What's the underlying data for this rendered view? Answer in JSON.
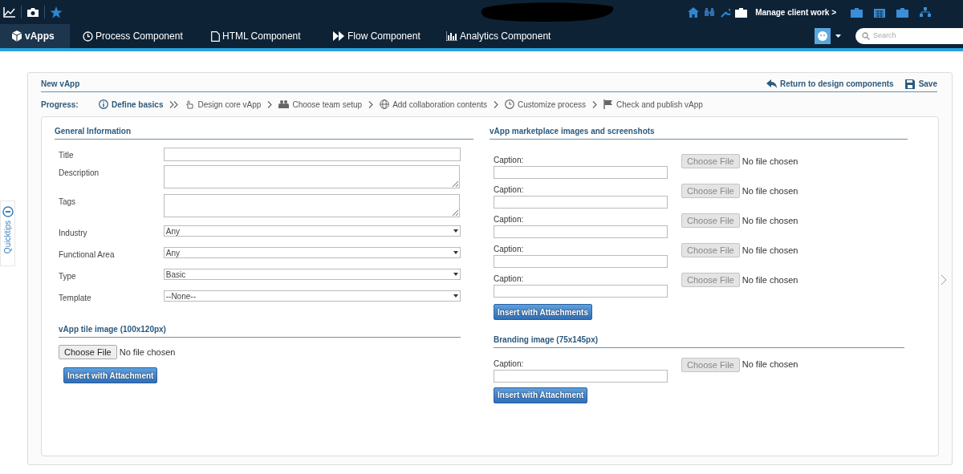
{
  "top_bar": {
    "manage_link": "Manage client work >"
  },
  "nav": {
    "tabs": [
      {
        "label": "vApps",
        "selected": true
      },
      {
        "label": "Process Component",
        "selected": false
      },
      {
        "label": "HTML Component",
        "selected": false
      },
      {
        "label": "Flow Component",
        "selected": false
      },
      {
        "label": "Analytics Component",
        "selected": false
      }
    ]
  },
  "search": {
    "placeholder": "Search"
  },
  "panel": {
    "title": "New vApp",
    "return_link": "Return to design components",
    "save": "Save"
  },
  "progress": {
    "label": "Progress:",
    "steps": [
      {
        "label": "Define basics",
        "selected": true
      },
      {
        "label": "Design core vApp",
        "selected": false
      },
      {
        "label": "Choose team setup",
        "selected": false
      },
      {
        "label": "Add collaboration contents",
        "selected": false
      },
      {
        "label": "Customize process",
        "selected": false
      },
      {
        "label": "Check and publish vApp",
        "selected": false
      }
    ]
  },
  "general": {
    "heading": "General Information",
    "fields": [
      {
        "label": "Title",
        "kind": "text"
      },
      {
        "label": "Description",
        "kind": "textarea"
      },
      {
        "label": "Tags",
        "kind": "textarea"
      },
      {
        "label": "Industry",
        "kind": "select",
        "value": "Any"
      },
      {
        "label": "Functional Area",
        "kind": "select",
        "value": "Any"
      },
      {
        "label": "Type",
        "kind": "select",
        "value": "Basic"
      },
      {
        "label": "Template",
        "kind": "select",
        "value": "--None--"
      }
    ]
  },
  "tile_image": {
    "heading": "vApp tile image (100x120px)",
    "file": {
      "button": "Choose File",
      "status": "No file chosen",
      "disabled": false
    },
    "insert_button": "Insert with Attachment"
  },
  "marketplace": {
    "heading": "vApp marketplace images and screenshots",
    "items": [
      {
        "caption_label": "Caption:",
        "file": {
          "button": "Choose File",
          "status": "No file chosen",
          "disabled": true
        }
      },
      {
        "caption_label": "Caption:",
        "file": {
          "button": "Choose File",
          "status": "No file chosen",
          "disabled": true
        }
      },
      {
        "caption_label": "Caption:",
        "file": {
          "button": "Choose File",
          "status": "No file chosen",
          "disabled": true
        }
      },
      {
        "caption_label": "Caption:",
        "file": {
          "button": "Choose File",
          "status": "No file chosen",
          "disabled": true
        }
      },
      {
        "caption_label": "Caption:",
        "file": {
          "button": "Choose File",
          "status": "No file chosen",
          "disabled": true
        }
      }
    ],
    "insert_button": "Insert with Attachments"
  },
  "branding": {
    "heading": "Branding image (75x145px)",
    "items": [
      {
        "caption_label": "Caption:",
        "file": {
          "button": "Choose File",
          "status": "No file chosen",
          "disabled": true
        }
      }
    ],
    "insert_button": "Insert with Attachment"
  },
  "quicktips": {
    "label": "Quicktips"
  }
}
